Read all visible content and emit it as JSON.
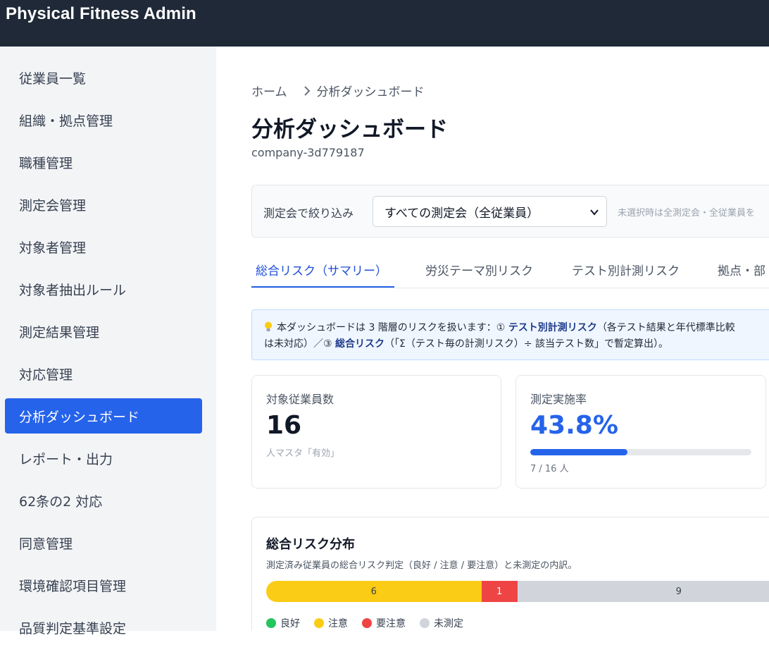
{
  "app": {
    "title": "Physical Fitness Admin"
  },
  "sidebar": {
    "items": [
      {
        "label": "従業員一覧",
        "active": false
      },
      {
        "label": "組織・拠点管理",
        "active": false
      },
      {
        "label": "職種管理",
        "active": false
      },
      {
        "label": "測定会管理",
        "active": false
      },
      {
        "label": "対象者管理",
        "active": false
      },
      {
        "label": "対象者抽出ルール",
        "active": false
      },
      {
        "label": "測定結果管理",
        "active": false
      },
      {
        "label": "対応管理",
        "active": false
      },
      {
        "label": "分析ダッシュボード",
        "active": true
      },
      {
        "label": "レポート・出力",
        "active": false
      },
      {
        "label": "62条の2 対応",
        "active": false
      },
      {
        "label": "同意管理",
        "active": false
      },
      {
        "label": "環境確認項目管理",
        "active": false
      },
      {
        "label": "品質判定基準設定",
        "active": false
      }
    ]
  },
  "breadcrumb": {
    "home": "ホーム",
    "current": "分析ダッシュボード"
  },
  "page": {
    "title": "分析ダッシュボード",
    "company_id": "company-3d779187"
  },
  "filter": {
    "label": "測定会で絞り込み",
    "selected": "すべての測定会（全従業員）",
    "hint": "未選択時は全測定会・全従業員を"
  },
  "tabs": [
    {
      "label": "総合リスク（サマリー）",
      "active": true
    },
    {
      "label": "労災テーマ別リスク",
      "active": false
    },
    {
      "label": "テスト別計測リスク",
      "active": false
    },
    {
      "label": "拠点・部",
      "active": false
    }
  ],
  "info": {
    "icon": "lightbulb-icon",
    "line1_prefix": "本ダッシュボードは 3 階層のリスクを扱います：① ",
    "line1_bold": "テスト別計測リスク",
    "line1_suffix": "（各テスト結果と年代標準比較",
    "line2_prefix": "は未対応）／③ ",
    "line2_bold": "総合リスク",
    "line2_suffix": "（「Σ（テスト毎の計測リスク）÷ 該当テスト数」で暫定算出）。"
  },
  "cards": {
    "employees": {
      "label": "対象従業員数",
      "value": "16",
      "sub": "人マスタ「有効」"
    },
    "rate": {
      "label": "測定実施率",
      "value": "43.8%",
      "progress": 0.438,
      "sub": "7 / 16 人"
    }
  },
  "distribution": {
    "title": "総合リスク分布",
    "description": "測定済み従業員の総合リスク判定（良好 / 注意 / 要注意）と未測定の内訳。",
    "segments": [
      {
        "key": "good",
        "label": "良好",
        "count": 0,
        "color": "#22c55e",
        "text_color": "#ffffff"
      },
      {
        "key": "caution",
        "label": "注意",
        "count": 6,
        "color": "#facc15",
        "text_color": "#374151"
      },
      {
        "key": "warning",
        "label": "要注意",
        "count": 1,
        "color": "#ef4444",
        "text_color": "#ffffff"
      },
      {
        "key": "unmeasured",
        "label": "未測定",
        "count": 9,
        "color": "#d1d5db",
        "text_color": "#374151"
      }
    ]
  },
  "colors": {
    "topbar": "#1f2937",
    "accent": "#2563eb",
    "sidebar_bg": "#f3f4f6"
  }
}
